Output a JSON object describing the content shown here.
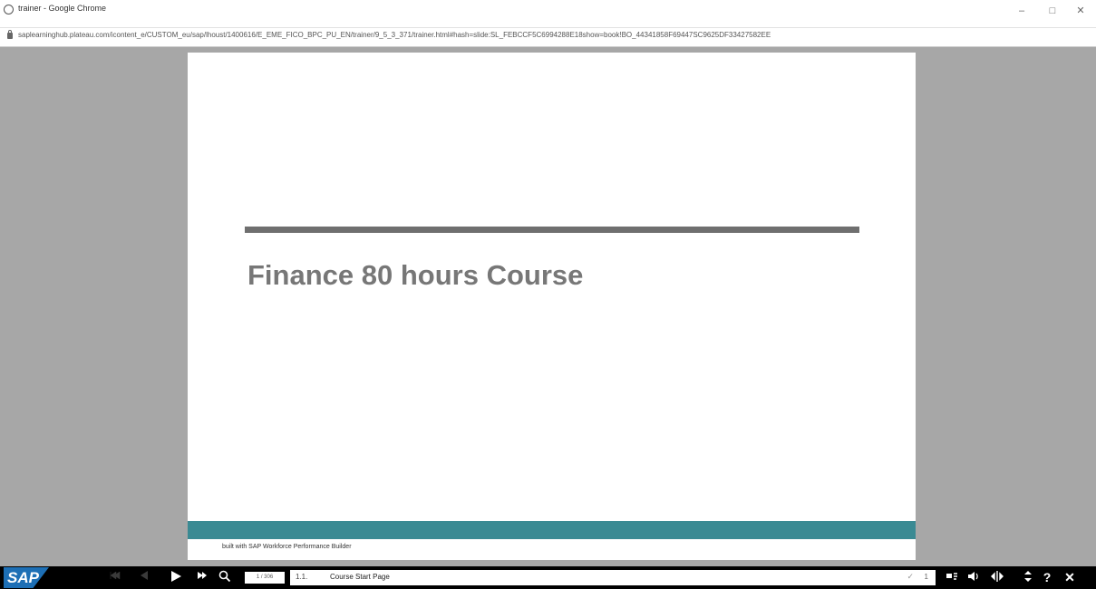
{
  "window": {
    "title": "trainer - Google Chrome",
    "minimize": "–",
    "maximize": "□",
    "close": "✕"
  },
  "address": {
    "url": "saplearninghub.plateau.com/icontent_e/CUSTOM_eu/sap/lhoust/1400616/E_EME_FICO_BPC_PU_EN/trainer/9_5_3_371/trainer.html#hash=slide:SL_FEBCCF5C6994288E18show=book!BO_44341858F69447SC9625DF33427582EE"
  },
  "slide": {
    "title": "Finance 80 hours Course",
    "footer_text": "built with SAP Workforce Performance Builder",
    "accent_color": "#3a8a93"
  },
  "toolbar": {
    "logo": "SAP",
    "icons": [
      "first-icon",
      "previous-icon",
      "play-icon",
      "next-icon",
      "search-icon"
    ],
    "pager": "1 / 306",
    "crumb_number": "1.1.",
    "crumb_title": "Course Start Page",
    "crumb_count": "1",
    "help": "?",
    "close": "✕"
  }
}
